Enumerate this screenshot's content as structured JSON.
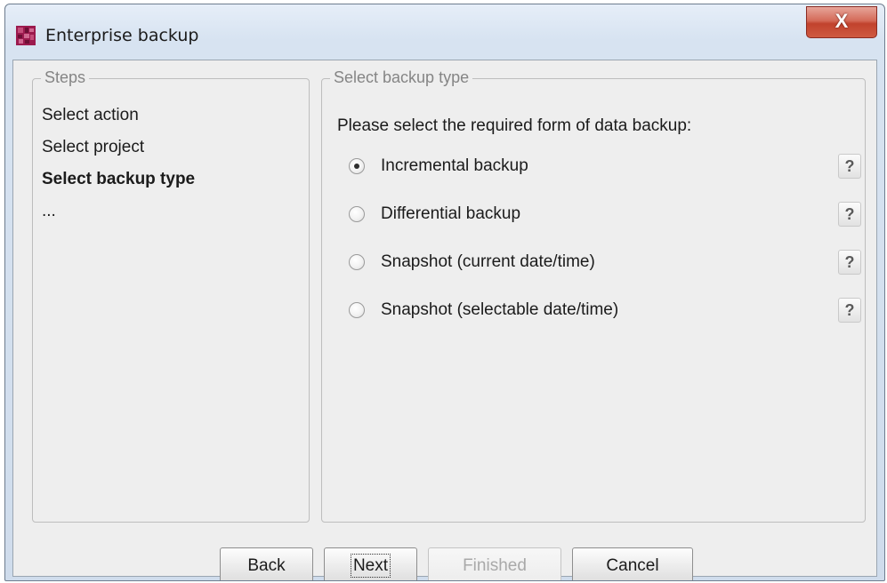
{
  "window": {
    "title": "Enterprise backup",
    "close_symbol": "X"
  },
  "steps_panel": {
    "legend": "Steps",
    "items": [
      {
        "label": "Select action"
      },
      {
        "label": "Select project"
      },
      {
        "label": "Select backup type",
        "current": true
      },
      {
        "label": "..."
      }
    ]
  },
  "type_panel": {
    "legend": "Select backup type",
    "prompt": "Please select the required form of data backup:",
    "options": [
      {
        "label": "Incremental backup",
        "selected": true,
        "help": "?"
      },
      {
        "label": "Differential backup",
        "selected": false,
        "help": "?"
      },
      {
        "label": "Snapshot (current date/time)",
        "selected": false,
        "help": "?"
      },
      {
        "label": "Snapshot (selectable date/time)",
        "selected": false,
        "help": "?"
      }
    ]
  },
  "buttons": {
    "back": "Back",
    "next": "Next",
    "finished": "Finished",
    "cancel": "Cancel"
  },
  "colors": {
    "brand_icon": "#9c1a4e",
    "close": "#c9503a"
  }
}
